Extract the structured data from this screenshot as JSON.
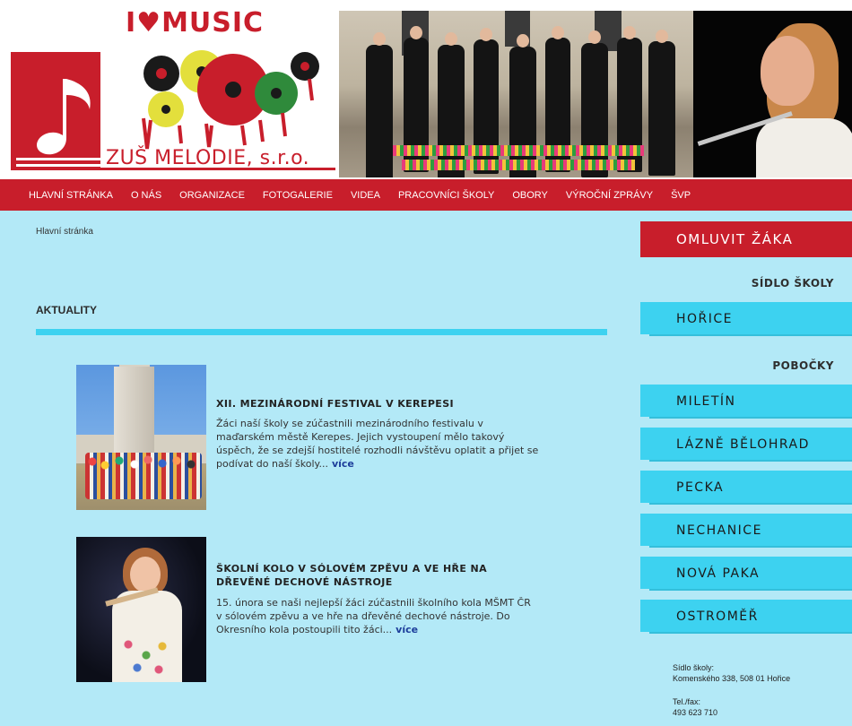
{
  "header": {
    "logo_tagline_prefix": "I",
    "logo_heart": "♥",
    "logo_tagline_suffix": "MUSIC",
    "school_name": "ZUŠ MELODIE, s.r.o.",
    "colors": {
      "brand": "#c81e2b",
      "nav": "#c81e2b",
      "content_bg": "#b3e9f7",
      "accent_cyan": "#3dd2f0"
    }
  },
  "nav": {
    "items": [
      "HLAVNÍ STRÁNKA",
      "O NÁS",
      "ORGANIZACE",
      "FOTOGALERIE",
      "VIDEA",
      "PRACOVNÍCI ŠKOLY",
      "OBORY",
      "VÝROČNÍ ZPRÁVY",
      "ŠVP"
    ]
  },
  "main": {
    "breadcrumb": "Hlavní stránka",
    "section_title": "AKTUALITY",
    "articles": [
      {
        "title": "XII. MEZINÁRODNÍ FESTIVAL V KEREPESI",
        "text": "Žáci naší školy se zúčastnili mezinárodního festivalu v maďarském městě Kerepes. Jejich vystoupení mělo takový úspěch, že se zdejší hostitelé rozhodli návštěvu oplatit a přijet se podívat do naší školy...",
        "more": "více"
      },
      {
        "title": "ŠKOLNÍ KOLO V SÓLOVÉM ZPĚVU A VE HŘE NA DŘEVĚNÉ DECHOVÉ NÁSTROJE",
        "text": "15. února se naši nejlepší žáci zúčastnili školního kola MŠMT ČR v sólovém zpěvu a ve hře na dřevěné dechové nástroje. Do Okresního kola postoupili tito žáci...",
        "more": "více"
      }
    ]
  },
  "sidebar": {
    "cta_label": "OMLUVIT ŽÁKA",
    "hq_heading": "SÍDLO ŠKOLY",
    "hq_items": [
      "HOŘICE"
    ],
    "branches_heading": "POBOČKY",
    "branches": [
      "MILETÍN",
      "LÁZNĚ BĚLOHRAD",
      "PECKA",
      "NECHANICE",
      "NOVÁ PAKA",
      "OSTROMĚŘ"
    ],
    "contact": {
      "address_label": "Sídlo školy:",
      "address": "Komenského 338, 508 01 Hořice",
      "phone_label": "Tel./fax:",
      "phone": "493 623 710"
    }
  }
}
